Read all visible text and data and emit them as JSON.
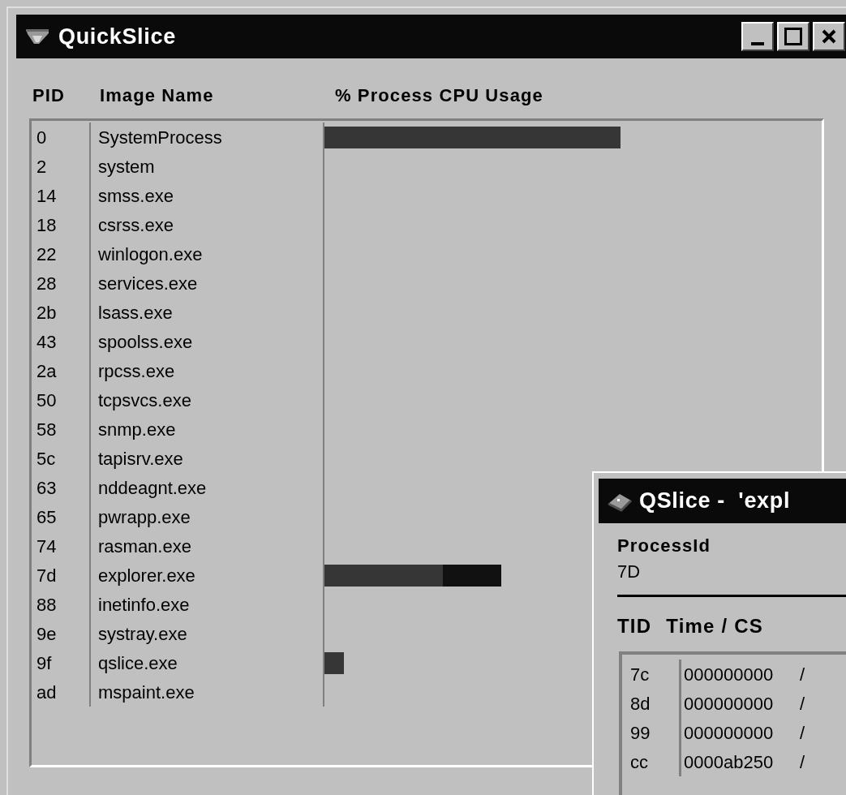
{
  "window": {
    "title": "QuickSlice"
  },
  "columns": [
    "PID",
    "Image Name",
    "% Process CPU Usage"
  ],
  "processes": [
    {
      "pid": "0",
      "name": "SystemProcess",
      "segments": [
        {
          "color": "#363636"
        }
      ]
    },
    {
      "pid": "2",
      "name": "system"
    },
    {
      "pid": "14",
      "name": "smss.exe"
    },
    {
      "pid": "18",
      "name": "csrss.exe"
    },
    {
      "pid": "22",
      "name": "winlogon.exe"
    },
    {
      "pid": "28",
      "name": "services.exe"
    },
    {
      "pid": "2b",
      "name": "lsass.exe"
    },
    {
      "pid": "43",
      "name": "spoolss.exe"
    },
    {
      "pid": "2a",
      "name": "rpcss.exe"
    },
    {
      "pid": "50",
      "name": "tcpsvcs.exe"
    },
    {
      "pid": "58",
      "name": "snmp.exe"
    },
    {
      "pid": "5c",
      "name": "tapisrv.exe"
    },
    {
      "pid": "63",
      "name": "nddeagnt.exe"
    },
    {
      "pid": "65",
      "name": "pwrapp.exe"
    },
    {
      "pid": "74",
      "name": "rasman.exe"
    },
    {
      "pid": "7d",
      "name": "explorer.exe",
      "segments": [
        {
          "color": "#363636"
        },
        {
          "color": "#111111"
        }
      ]
    },
    {
      "pid": "88",
      "name": "inetinfo.exe"
    },
    {
      "pid": "9e",
      "name": "systray.exe"
    },
    {
      "pid": "9f",
      "name": "qslice.exe",
      "segments": [
        {
          "color": "#363636"
        }
      ]
    },
    {
      "pid": "ad",
      "name": "mspaint.exe"
    }
  ],
  "detail_window": {
    "title": "QSlice -  'expl",
    "label": "ProcessId",
    "value": "7D",
    "columns": [
      "TID",
      "Time / CS"
    ],
    "threads": [
      {
        "tid": "7c",
        "time": "000000000",
        "column_3": "/"
      },
      {
        "tid": "8d",
        "time": "000000000",
        "column_3": "/"
      },
      {
        "tid": "99",
        "time": "000000000",
        "column_3": "/"
      },
      {
        "tid": "cc",
        "time": "0000ab250",
        "column_3": "/"
      }
    ]
  }
}
